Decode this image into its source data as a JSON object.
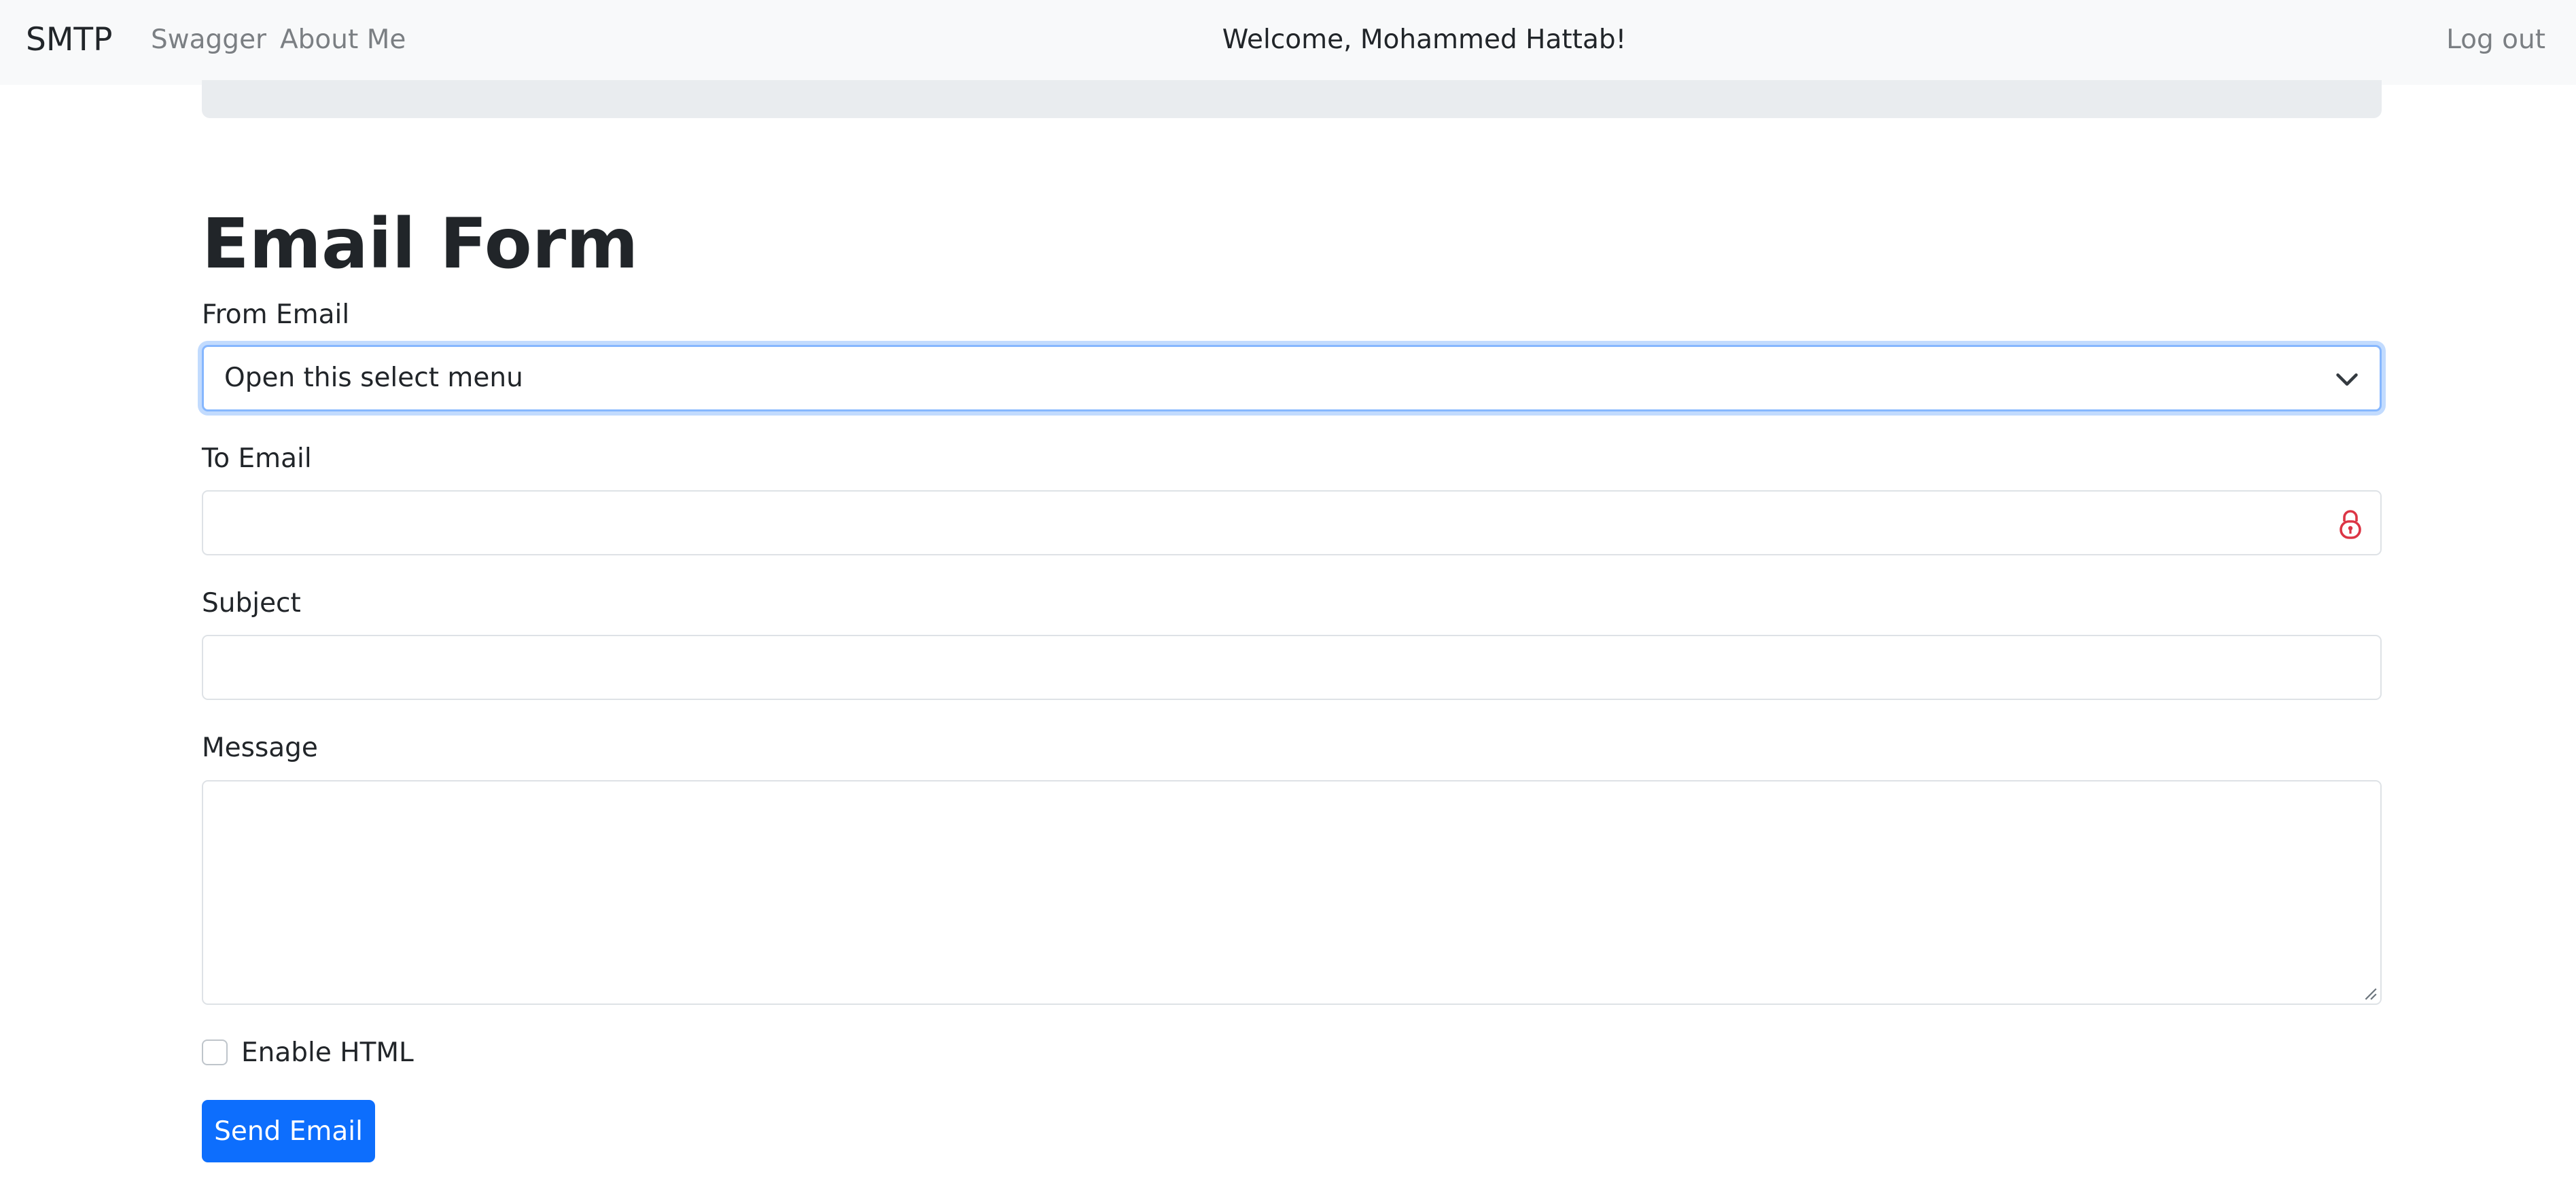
{
  "navbar": {
    "brand": "SMTP",
    "links": [
      "Swagger",
      "About Me"
    ],
    "welcome": "Welcome, Mohammed Hattab!",
    "logout": "Log out"
  },
  "form": {
    "title": "Email Form",
    "from_label": "From Email",
    "from_select_value": "Open this select menu",
    "to_label": "To Email",
    "to_value": "",
    "subject_label": "Subject",
    "subject_value": "",
    "message_label": "Message",
    "message_value": "",
    "html_checkbox_label": "Enable HTML",
    "html_checkbox_checked": false,
    "send_label": "Send Email"
  },
  "icons": {
    "select_arrow": "chevron-down-icon",
    "to_field_addon": "password-manager-lock-icon",
    "textarea_corner": "resize-grip-icon"
  },
  "colors": {
    "primary": "#0d6efd",
    "navbar_bg": "#f8f9fa",
    "banner_bg": "#e9ecef",
    "focus_border": "#86b7fe",
    "lock_icon": "#dc3545"
  }
}
